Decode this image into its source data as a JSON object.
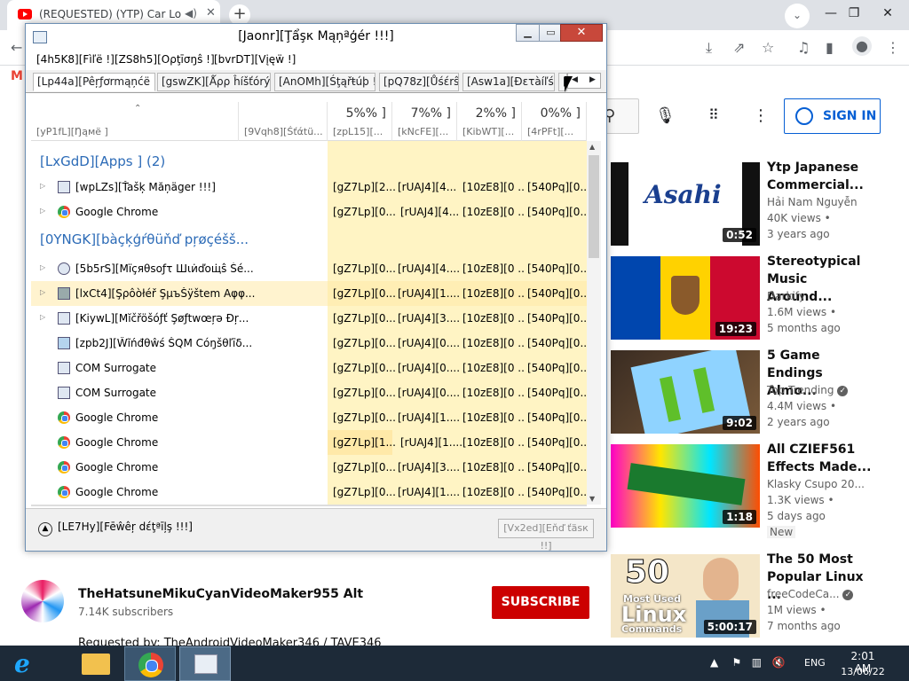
{
  "browser": {
    "tab_title": "(REQUESTED) (YTP) Car Logo",
    "window_controls": {
      "minimize": "—",
      "restore": "❐",
      "close": "✕"
    }
  },
  "youtube": {
    "sign_in": "SIGN IN",
    "channel": {
      "name": "TheHatsuneMikuCyanVideoMaker955 Alt",
      "subscribers": "7.14K subscribers",
      "subscribe": "SUBSCRIBE"
    },
    "description_line": "Requested by: TheAndroidVideoMaker346 / TAVE346",
    "recommendations": [
      {
        "title": "Ytp Japanese Commercial...",
        "channel": "Hải Nam Nguyễn",
        "views": "40K views •",
        "age": "3 years ago",
        "duration": "0:52",
        "verified": false,
        "new": ""
      },
      {
        "title": "Stereotypical Music Around...",
        "channel": "Darkify",
        "views": "1.6M views •",
        "age": "5 months ago",
        "duration": "19:23",
        "verified": false,
        "new": ""
      },
      {
        "title": "5 Game Endings Almo...",
        "channel": "Top Trending",
        "views": "4.4M views •",
        "age": "2 years ago",
        "duration": "9:02",
        "verified": true,
        "new": ""
      },
      {
        "title": "All CZIEF561 Effects Made...",
        "channel": "Klasky Csupo 20...",
        "views": "1.3K views •",
        "age": "5 days ago",
        "duration": "1:18",
        "verified": false,
        "new": "New"
      },
      {
        "title": "The 50 Most Popular Linux ...",
        "channel": "freeCodeCa...",
        "views": "1M views •",
        "age": "7 months ago",
        "duration": "5:00:17",
        "verified": true,
        "new": ""
      }
    ],
    "thumb_texts": {
      "asahi": "Asahi",
      "linux_num": "50",
      "linux_line1": "Most Used",
      "linux_line2": "Linux",
      "linux_line3": "Commands"
    }
  },
  "taskmgr": {
    "title": "[Jaonr][Ţẩşκ Mąņªģér !!!]",
    "menu": [
      "[4h5K8][Fìľë !]",
      "[ZS8h5][Oρţīσŋŝ !]",
      "[bvrDT][Vįęẅ !]"
    ],
    "tabs": [
      "[Lp44a][Pêŗƒơrmąņćë !!]",
      "[gswZK][Ǻρρ ĥíšťórý !!]",
      "[AnOMh][Śţąřŧúþ !]",
      "[pQ78z][Ůśέrŝ !]",
      "[Asw1a][Ðετàíľś !]",
      "[..."
    ],
    "columns": {
      "name": "[yP1fL][Ŋąмё ]",
      "status": "[9Vqh8][Śťάtü...",
      "cpu": {
        "pct": "5%% ]",
        "label": "[zpL15][..."
      },
      "memory": {
        "pct": "7%% ]",
        "label": "[kNcFE][..."
      },
      "disk": {
        "pct": "2%% ]",
        "label": "[KibWT][..."
      },
      "network": {
        "pct": "0%% ]",
        "label": "[4rPFt][..."
      }
    },
    "groups": {
      "apps": "[LxGdD][Apps ] (2)",
      "background": "[0YNGK][bàçķģŕθüňď pŗøçéšš..."
    },
    "app_rows": [
      {
        "name": "[wpLZs][Ťašķ Măņäger !!!]",
        "cpu": "[gZ7Lp][2...",
        "mem": "[rUAJ4][4...",
        "disk": "[10zE8][0 ...",
        "net": "[540Pq][0..."
      },
      {
        "name": "Google Chrome",
        "cpu": "[gZ7Lp][0...",
        "mem": "[rUAJ4][4...",
        "disk": "[10zE8][0 ...",
        "net": "[540Pq][0..."
      }
    ],
    "bg_rows": [
      {
        "name": "[5b5rS][Mïçяθsoƒτ Шιи̇ďoщ̇ŝ Śé...",
        "cpu": "[gZ7Lp][0...",
        "mem": "[rUAJ4][4....",
        "disk": "[10zE8][0 ...",
        "net": "[540Pq][0..."
      },
      {
        "name": "[lxCt4][Şρôòłéř ŞμъŠÿštem Aφφ...",
        "cpu": "[gZ7Lp][0...",
        "mem": "[rUAJ4][1....",
        "disk": "[10zE8][0 ...",
        "net": "[540Pq][0..."
      },
      {
        "name": "[KiywL][Mĭčřöšóƒť Şøƒtwœŗə Ðŗ...",
        "cpu": "[gZ7Lp][0...",
        "mem": "[rUAJ4][3....",
        "disk": "[10zE8][0 ...",
        "net": "[540Pq][0..."
      },
      {
        "name": "[zpb2J][Ŵĩńđθŵś ŠQM Cóŋšθľīδ...",
        "cpu": "[gZ7Lp][0...",
        "mem": "[rUAJ4][0....",
        "disk": "[10zE8][0 ...",
        "net": "[540Pq][0..."
      },
      {
        "name": "COM Surrogate",
        "cpu": "[gZ7Lp][0...",
        "mem": "[rUAJ4][0....",
        "disk": "[10zE8][0 ...",
        "net": "[540Pq][0..."
      },
      {
        "name": "COM Surrogate",
        "cpu": "[gZ7Lp][0...",
        "mem": "[rUAJ4][0....",
        "disk": "[10zE8][0 ...",
        "net": "[540Pq][0..."
      },
      {
        "name": "Google Chrome",
        "cpu": "[gZ7Lp][0...",
        "mem": "[rUAJ4][1....",
        "disk": "[10zE8][0 ...",
        "net": "[540Pq][0..."
      },
      {
        "name": "Google Chrome",
        "cpu": "[gZ7Lp][1...",
        "mem": "[rUAJ4][1....",
        "disk": "[10zE8][0 ...",
        "net": "[540Pq][0..."
      },
      {
        "name": "Google Chrome",
        "cpu": "[gZ7Lp][0...",
        "mem": "[rUAJ4][3....",
        "disk": "[10zE8][0 ...",
        "net": "[540Pq][0..."
      },
      {
        "name": "Google Chrome",
        "cpu": "[gZ7Lp][0...",
        "mem": "[rUAJ4][1....",
        "disk": "[10zE8][0 ...",
        "net": "[540Pq][0..."
      }
    ],
    "fewer_details": "[LE7Hy][Fēŵêŗ dέţªīļş !!!]",
    "end_task": "[Vx2ed][Eňď ťäsк !!]"
  },
  "taskbar": {
    "language": "ENG",
    "time": "2:01 AM",
    "date": "13/06/22"
  },
  "colors": {
    "yt_red": "#cc0000",
    "yt_blue": "#065fd4",
    "tm_heat": "#fff4c4",
    "tm_heat_strong": "#ffe9a8",
    "group_blue": "#2c6bb7"
  }
}
